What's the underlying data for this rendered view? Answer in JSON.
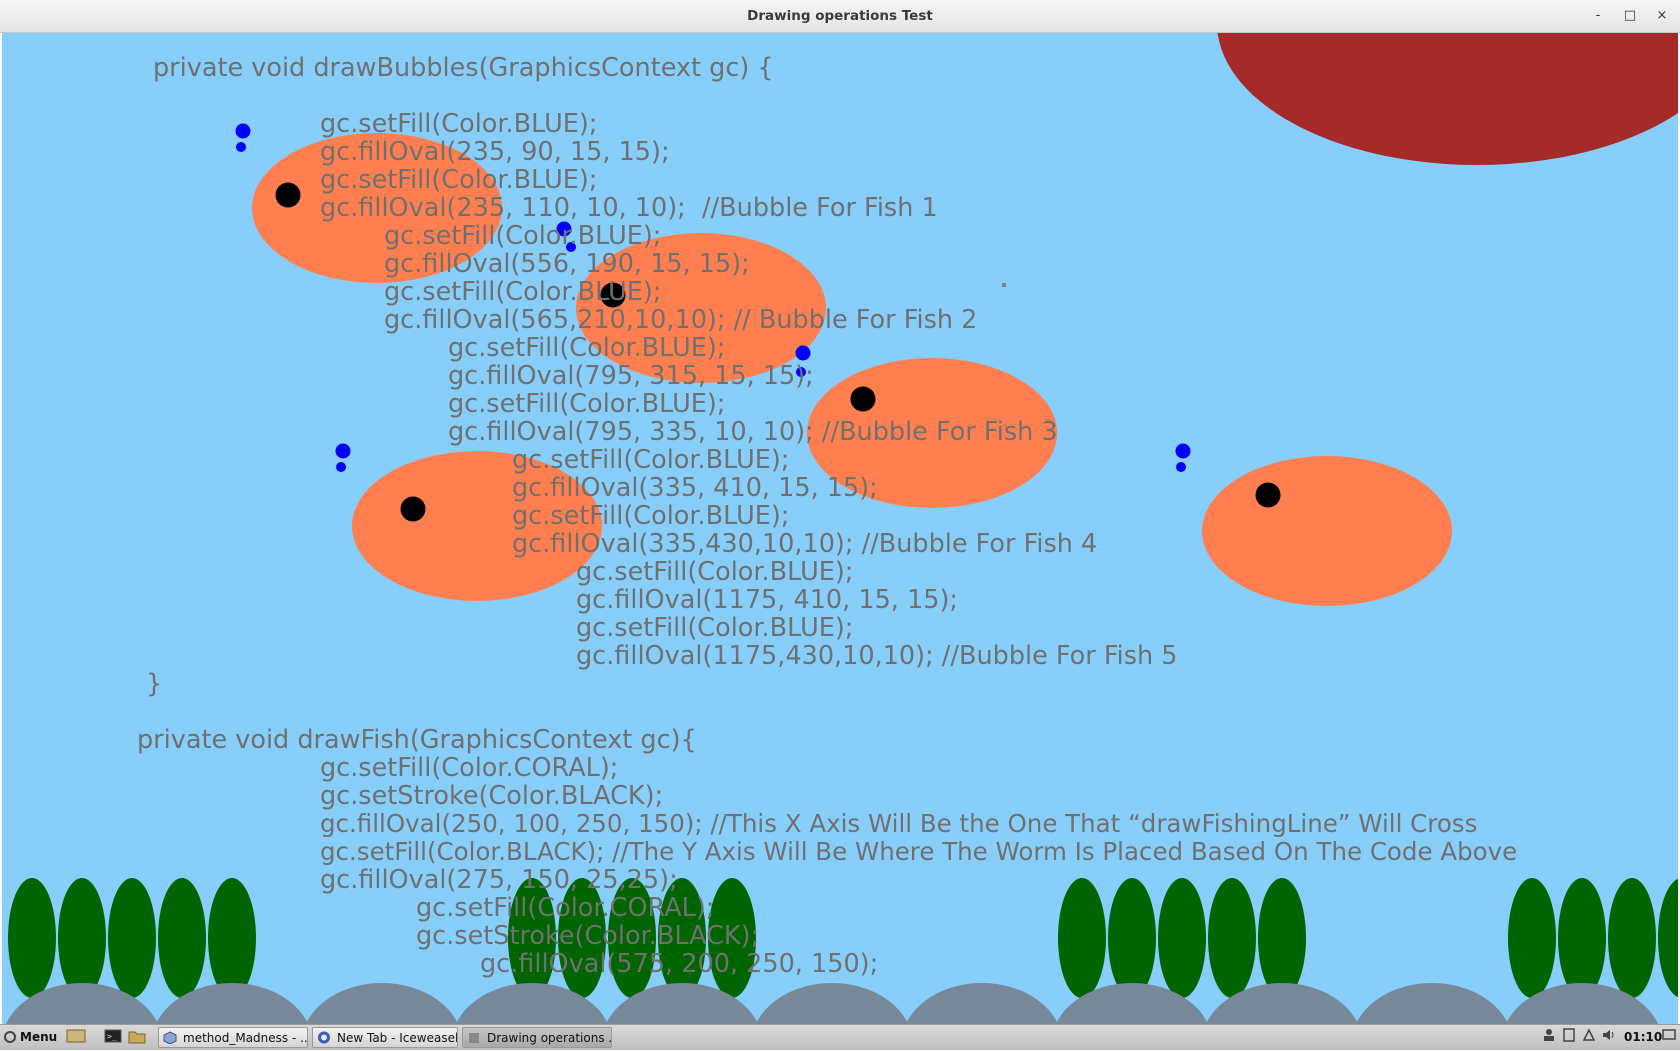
{
  "window": {
    "title": "Drawing operations Test",
    "buttons": {
      "minimize": "-",
      "maximize": "□",
      "close": "×"
    }
  },
  "code_lines": [
    "private void drawBubbles(GraphicsContext gc) {",
    "gc.setFill(Color.BLUE);",
    "gc.fillOval(235, 90, 15, 15);",
    "gc.setFill(Color.BLUE);",
    "gc.fillOval(235, 110, 10, 10);  //Bubble For Fish 1",
    "gc.setFill(Color.BLUE);",
    "gc.fillOval(556, 190, 15, 15);",
    "gc.setFill(Color.BLUE);",
    "gc.fillOval(565,210,10,10); // Bubble For Fish 2",
    "gc.setFill(Color.BLUE);",
    "gc.fillOval(795, 315, 15, 15);",
    "gc.setFill(Color.BLUE);",
    "gc.fillOval(795, 335, 10, 10); //Bubble For Fish 3",
    "gc.setFill(Color.BLUE);",
    "gc.fillOval(335, 410, 15, 15);",
    "gc.setFill(Color.BLUE);",
    "gc.fillOval(335,430,10,10); //Bubble For Fish 4",
    "gc.setFill(Color.BLUE);",
    "gc.fillOval(1175, 410, 15, 15);",
    "gc.setFill(Color.BLUE);",
    "gc.fillOval(1175,430,10,10); //Bubble For Fish 5",
    "}",
    "private void drawFish(GraphicsContext gc){",
    "gc.setFill(Color.CORAL);",
    "gc.setStroke(Color.BLACK);",
    "gc.fillOval(250, 100, 250, 150); //This X Axis Will Be the One That “drawFishingLine” Will Cross",
    "gc.setFill(Color.BLACK); //The Y Axis Will Be Where The Worm Is Placed Based On The Code Above",
    "gc.fillOval(275, 150, 25,25);",
    "gc.setFill(Color.CORAL);",
    "gc.setStroke(Color.BLACK);",
    "gc.fillOval(575, 200, 250, 150);"
  ],
  "colors": {
    "sky": "#87cefa",
    "sun": "#a52a2a",
    "fish": "#ff7f50",
    "eye": "#000000",
    "bubble": "#0000ff",
    "plant": "#006400",
    "rock": "#778899",
    "code_text": "#707070"
  },
  "taskbar": {
    "menu_label": "Menu",
    "tasks": [
      {
        "label": "method_Madness - ...",
        "icon": "eclipse-icon"
      },
      {
        "label": "New Tab - Iceweasel",
        "icon": "iceweasel-icon"
      },
      {
        "label": "Drawing operations ...",
        "icon": "java-icon"
      }
    ],
    "clock": "01:10"
  }
}
